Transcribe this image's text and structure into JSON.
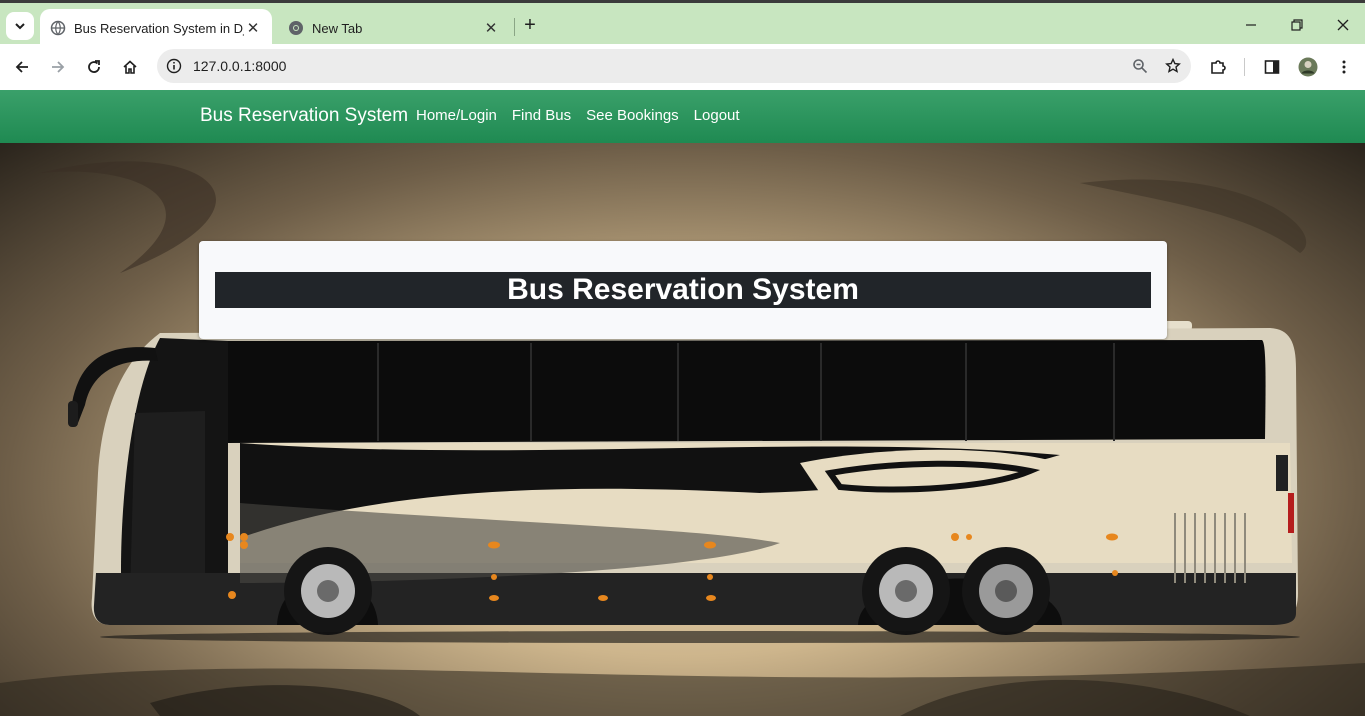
{
  "browser": {
    "tabs": [
      {
        "title": "Bus Reservation System in Djan",
        "active": true
      },
      {
        "title": "New Tab",
        "active": false
      }
    ],
    "url": "127.0.0.1:8000"
  },
  "navbar": {
    "brand": "Bus Reservation System",
    "links": [
      "Home/Login",
      "Find Bus",
      "See Bookings",
      "Logout"
    ],
    "color": "#2a9660"
  },
  "hero": {
    "title": "Bus Reservation System",
    "image": "bus-illustration"
  }
}
